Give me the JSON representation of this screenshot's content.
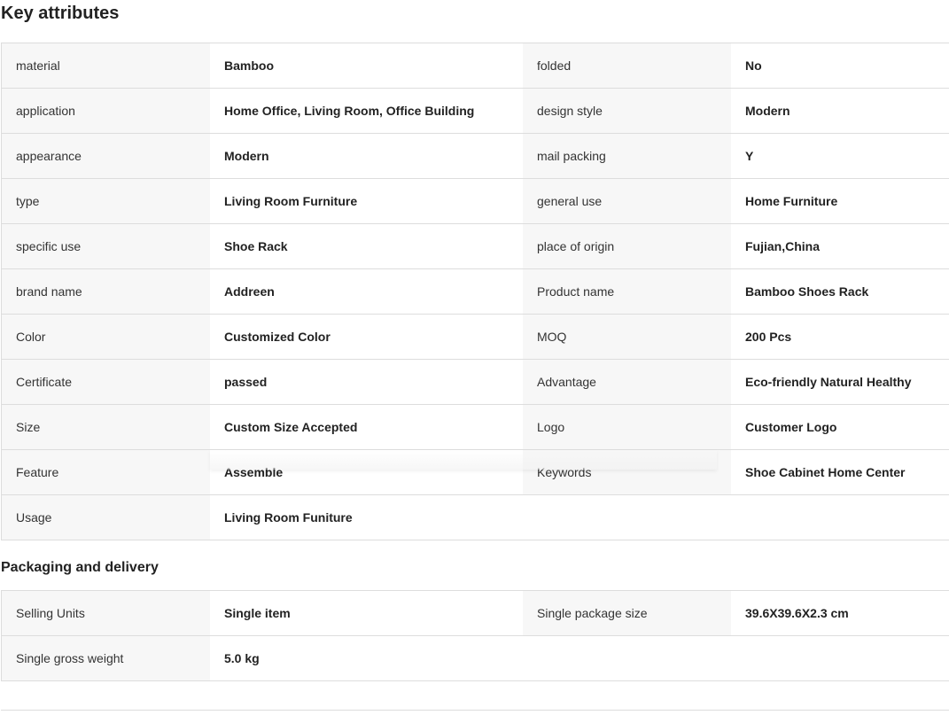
{
  "key_attributes": {
    "title": "Key attributes",
    "rows": [
      {
        "l1": "material",
        "v1": "Bamboo",
        "l2": "folded",
        "v2": "No"
      },
      {
        "l1": "application",
        "v1": "Home Office, Living Room, Office Building",
        "l2": "design style",
        "v2": "Modern"
      },
      {
        "l1": "appearance",
        "v1": "Modern",
        "l2": "mail packing",
        "v2": "Y"
      },
      {
        "l1": "type",
        "v1": "Living Room Furniture",
        "l2": "general use",
        "v2": "Home Furniture"
      },
      {
        "l1": "specific use",
        "v1": "Shoe Rack",
        "l2": "place of origin",
        "v2": "Fujian,China"
      },
      {
        "l1": "brand name",
        "v1": "Addreen",
        "l2": "Product name",
        "v2": "Bamboo Shoes Rack"
      },
      {
        "l1": "Color",
        "v1": "Customized Color",
        "l2": "MOQ",
        "v2": "200 Pcs"
      },
      {
        "l1": "Certificate",
        "v1": "passed",
        "l2": "Advantage",
        "v2": "Eco-friendly Natural Healthy"
      },
      {
        "l1": "Size",
        "v1": "Custom Size Accepted",
        "l2": "Logo",
        "v2": "Customer Logo"
      },
      {
        "l1": "Feature",
        "v1": "Assemble",
        "l2": "Keywords",
        "v2": "Shoe Cabinet Home Center"
      },
      {
        "l1": "Usage",
        "v1": "Living Room Funiture",
        "l2": "",
        "v2": ""
      }
    ]
  },
  "packaging": {
    "title": "Packaging and delivery",
    "rows": [
      {
        "l1": "Selling Units",
        "v1": "Single item",
        "l2": "Single package size",
        "v2": "39.6X39.6X2.3 cm"
      },
      {
        "l1": "Single gross weight",
        "v1": "5.0 kg",
        "l2": "",
        "v2": ""
      }
    ]
  }
}
